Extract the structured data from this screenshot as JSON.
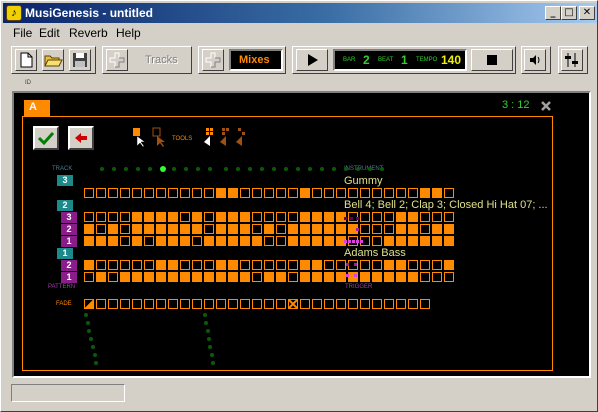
{
  "window": {
    "title": "MusiGenesis - untitled"
  },
  "menu": {
    "file": "File",
    "edit": "Edit",
    "reverb": "Reverb",
    "help": "Help"
  },
  "toolbar": {
    "tracks_label": "Tracks",
    "mixes_label": "Mixes",
    "bar_label": "BAR",
    "bar_value": "2",
    "beat_label": "BEAT",
    "beat_value": "1",
    "tempo_label": "TEMPO",
    "tempo_value": "140"
  },
  "id_label": "ID",
  "mix": {
    "tab_label": "A",
    "time": "3 : 12",
    "tools_label": "TOOLS",
    "track_label": "TRACK",
    "instrument_label": "INSTRUMENT",
    "pattern_label": "PATTERN",
    "trigger_label": "TRIGGER",
    "fade_label": "FADE"
  },
  "tracks": [
    {
      "number": "3",
      "instrument": "Gummy",
      "patterns": [
        {
          "number": "",
          "cells": [
            0,
            0,
            0,
            0,
            0,
            0,
            0,
            0,
            0,
            0,
            0,
            1,
            1,
            0,
            0,
            0,
            0,
            0,
            1,
            0,
            0,
            0,
            0,
            0,
            0,
            0,
            0,
            0,
            1,
            1,
            0
          ]
        }
      ]
    },
    {
      "number": "2",
      "instrument": "Bell 4; Bell 2; Clap 3; Closed Hi Hat 07;  ...",
      "patterns": [
        {
          "number": "3",
          "cells": [
            0,
            0,
            0,
            0,
            1,
            1,
            1,
            1,
            0,
            1,
            0,
            1,
            1,
            1,
            0,
            0,
            0,
            0,
            1,
            1,
            1,
            1,
            0,
            0,
            0,
            0,
            1,
            1,
            0,
            0,
            0
          ]
        },
        {
          "number": "2",
          "cells": [
            1,
            0,
            1,
            0,
            1,
            1,
            1,
            1,
            1,
            1,
            0,
            1,
            1,
            1,
            0,
            1,
            0,
            1,
            1,
            1,
            1,
            1,
            1,
            0,
            0,
            0,
            1,
            1,
            0,
            1,
            1
          ]
        },
        {
          "number": "1",
          "cells": [
            1,
            1,
            1,
            0,
            1,
            0,
            1,
            1,
            1,
            0,
            1,
            1,
            1,
            1,
            1,
            0,
            0,
            1,
            1,
            1,
            1,
            1,
            0,
            0,
            0,
            1,
            1,
            1,
            1,
            1,
            1
          ]
        }
      ]
    },
    {
      "number": "1",
      "instrument": "Adams Bass",
      "patterns": [
        {
          "number": "2",
          "cells": [
            1,
            0,
            0,
            0,
            0,
            0,
            1,
            1,
            0,
            0,
            0,
            1,
            1,
            0,
            0,
            0,
            0,
            0,
            1,
            1,
            0,
            0,
            0,
            0,
            0,
            1,
            1,
            0,
            0,
            0,
            1
          ]
        },
        {
          "number": "1",
          "cells": [
            0,
            1,
            0,
            1,
            1,
            1,
            1,
            1,
            1,
            1,
            1,
            1,
            1,
            1,
            0,
            1,
            1,
            0,
            1,
            1,
            1,
            1,
            1,
            1,
            1,
            1,
            1,
            1,
            0,
            0,
            0
          ]
        }
      ]
    }
  ],
  "fade_cells": [
    1,
    0,
    0,
    0,
    0,
    0,
    0,
    0,
    0,
    0,
    0,
    0,
    0,
    0,
    0,
    0,
    0,
    1,
    0,
    0,
    0,
    0,
    0,
    0,
    0,
    0,
    0,
    0,
    0
  ],
  "colors": {
    "accent_orange": "#ff8a00",
    "track_teal": "#1d8a8a",
    "pattern_purple": "#8a1d8a",
    "time_green": "#30d030",
    "instrument_yellow": "#e0e08a"
  }
}
